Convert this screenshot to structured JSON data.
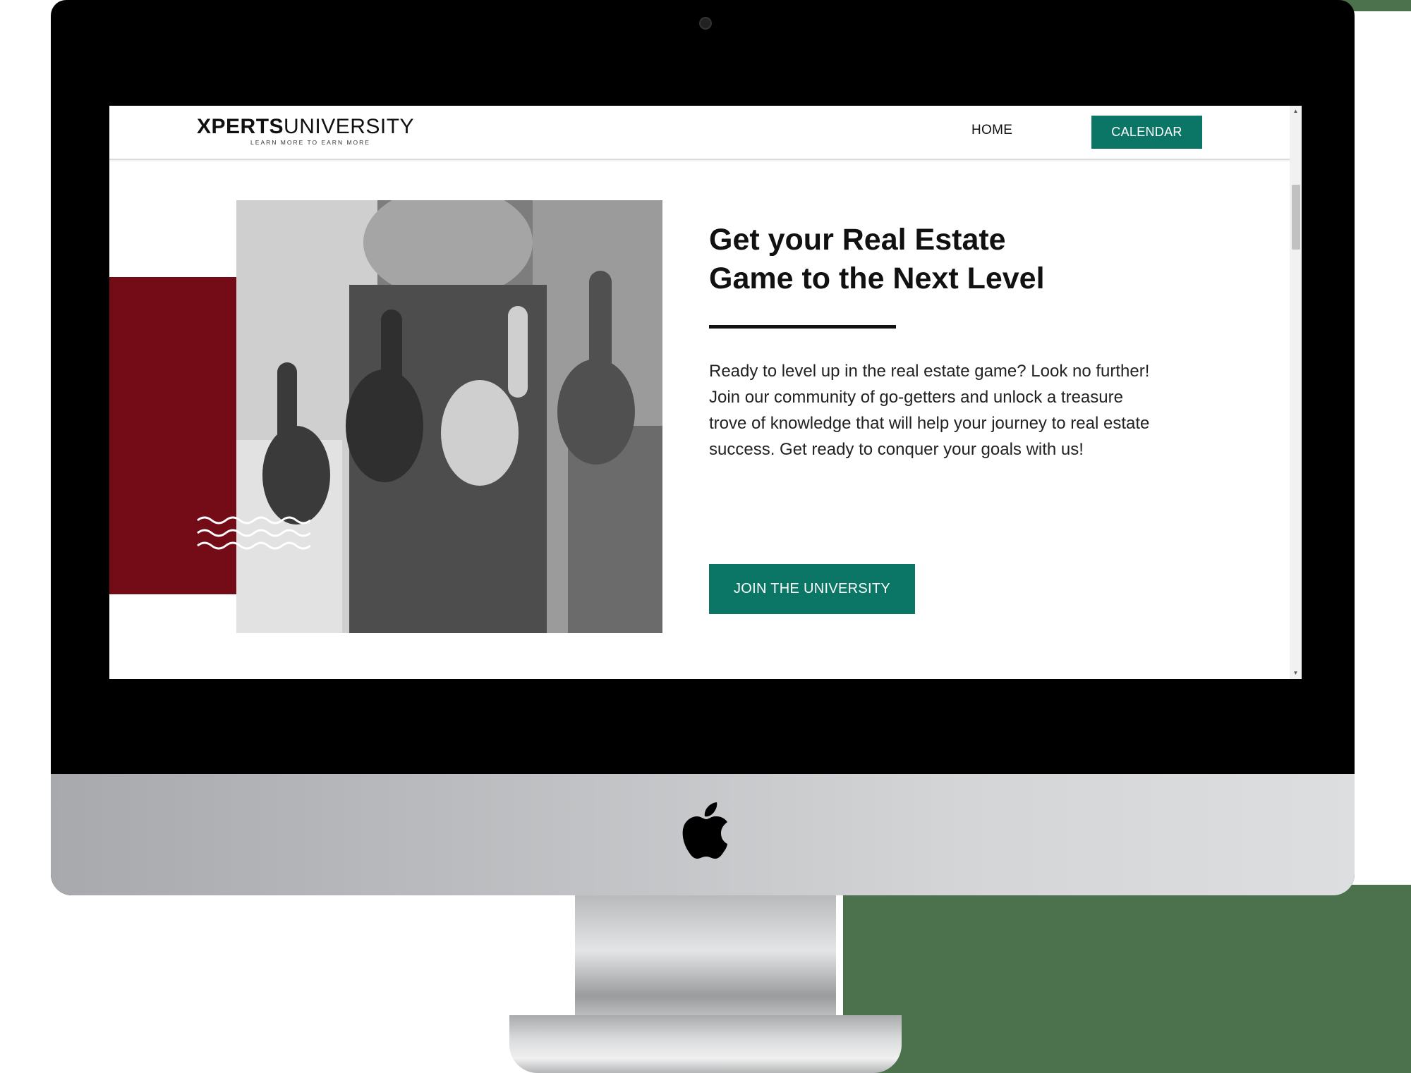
{
  "brand": {
    "name_bold": "XPERTS",
    "name_light": "UNIVERSITY",
    "tagline": "LEARN MORE TO EARN MORE"
  },
  "nav": {
    "items": [
      {
        "label": "HOME"
      },
      {
        "label": "CALENDAR"
      }
    ]
  },
  "hero": {
    "headline_line1": "Get your Real Estate",
    "headline_line2": "Game to the Next Level",
    "body": "Ready to level up in the real estate game? Look no further! Join our community of go-getters and unlock a treasure trove of knowledge that will help your journey to real estate success. Get ready to conquer your goals with us!",
    "cta_label": "JOIN THE UNIVERSITY",
    "image_description_icon": "thumbs-up-photo"
  },
  "colors": {
    "accent_teal": "#0b7666",
    "accent_maroon": "#730c17",
    "text_dark": "#111111",
    "background_green": "#4b714d"
  }
}
